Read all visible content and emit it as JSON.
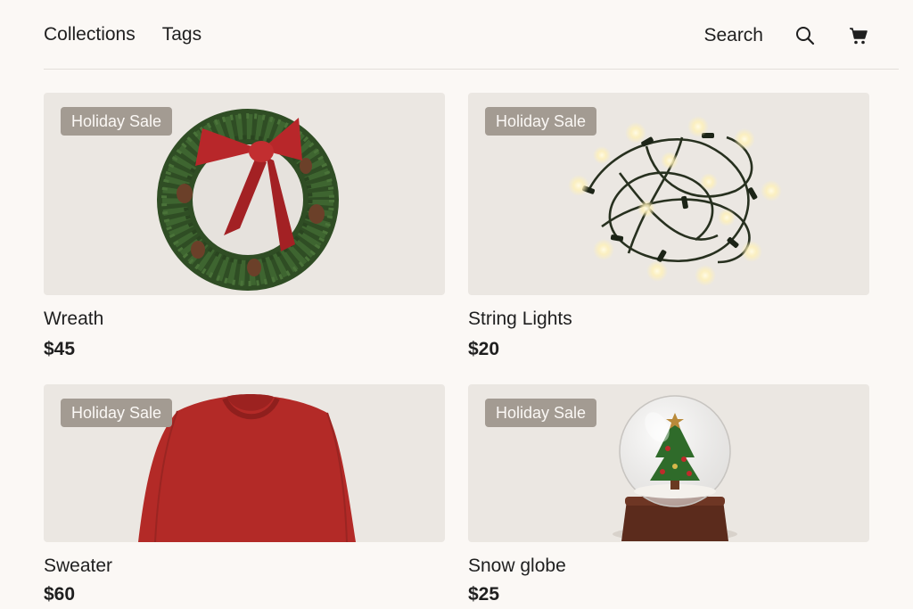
{
  "nav": {
    "links": [
      "Collections",
      "Tags"
    ],
    "search_label": "Search",
    "icons": [
      "search-icon",
      "cart-icon"
    ]
  },
  "products": [
    {
      "badge": "Holiday Sale",
      "title": "Wreath",
      "price": "$45",
      "image": "wreath"
    },
    {
      "badge": "Holiday Sale",
      "title": "String Lights",
      "price": "$20",
      "image": "string-lights"
    },
    {
      "badge": "Holiday Sale",
      "title": "Sweater",
      "price": "$60",
      "image": "sweater"
    },
    {
      "badge": "Holiday Sale",
      "title": "Snow globe",
      "price": "$25",
      "image": "snow-globe"
    }
  ],
  "colors": {
    "background": "#fbf8f5",
    "badge_bg": "#a39b92",
    "text": "#1f1f1f",
    "accent_red": "#b8272a",
    "pine_green": "#3b5d2e"
  }
}
